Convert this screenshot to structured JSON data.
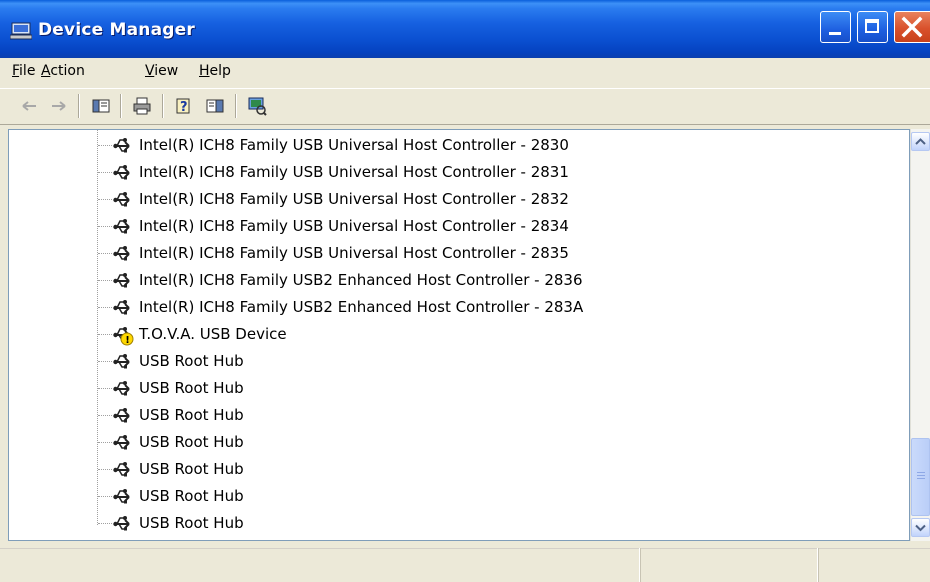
{
  "window": {
    "title": "Device Manager"
  },
  "menu": [
    {
      "key": "F",
      "rest": "ile"
    },
    {
      "key": "A",
      "rest": "ction"
    },
    {
      "key": "V",
      "rest": "iew"
    },
    {
      "key": "H",
      "rest": "elp"
    }
  ],
  "toolbar": {
    "icons": [
      "back-arrow-icon",
      "forward-arrow-icon",
      "show-hide-console-tree-icon",
      "print-icon",
      "help-icon",
      "properties-icon",
      "scan-hardware-changes-icon"
    ]
  },
  "tree": {
    "items": [
      {
        "label": "Intel(R) ICH8 Family USB Universal Host Controller - 2830",
        "icon": "usb-icon",
        "warning": false
      },
      {
        "label": "Intel(R) ICH8 Family USB Universal Host Controller - 2831",
        "icon": "usb-icon",
        "warning": false
      },
      {
        "label": "Intel(R) ICH8 Family USB Universal Host Controller - 2832",
        "icon": "usb-icon",
        "warning": false
      },
      {
        "label": "Intel(R) ICH8 Family USB Universal Host Controller - 2834",
        "icon": "usb-icon",
        "warning": false
      },
      {
        "label": "Intel(R) ICH8 Family USB Universal Host Controller - 2835",
        "icon": "usb-icon",
        "warning": false
      },
      {
        "label": "Intel(R) ICH8 Family USB2 Enhanced Host Controller - 2836",
        "icon": "usb-icon",
        "warning": false
      },
      {
        "label": "Intel(R) ICH8 Family USB2 Enhanced Host Controller - 283A",
        "icon": "usb-icon",
        "warning": false
      },
      {
        "label": "T.O.V.A. USB Device",
        "icon": "usb-warning-icon",
        "warning": true
      },
      {
        "label": "USB Root Hub",
        "icon": "usb-icon",
        "warning": false
      },
      {
        "label": "USB Root Hub",
        "icon": "usb-icon",
        "warning": false
      },
      {
        "label": "USB Root Hub",
        "icon": "usb-icon",
        "warning": false
      },
      {
        "label": "USB Root Hub",
        "icon": "usb-icon",
        "warning": false
      },
      {
        "label": "USB Root Hub",
        "icon": "usb-icon",
        "warning": false
      },
      {
        "label": "USB Root Hub",
        "icon": "usb-icon",
        "warning": false
      },
      {
        "label": "USB Root Hub",
        "icon": "usb-icon",
        "warning": false
      }
    ]
  },
  "colors": {
    "titlebar": "#0A4FD0",
    "close_button": "#D9512C",
    "warning": "#FFD800"
  }
}
